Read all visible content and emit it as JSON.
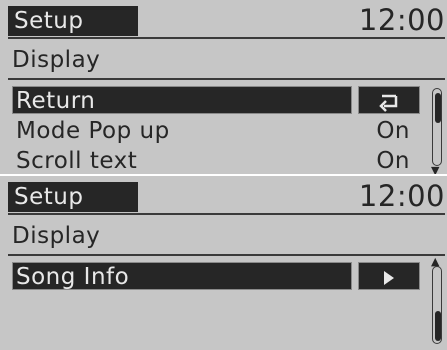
{
  "screens": [
    {
      "title": "Setup",
      "clock": "12:00",
      "subtitle": "Display",
      "rows": [
        {
          "label": "Return",
          "action_icon": "return-arrow-icon",
          "action_glyph": "⮌"
        },
        {
          "label": "Mode Pop up",
          "value": "On"
        },
        {
          "label": "Scroll text",
          "value": "On"
        }
      ],
      "scroll": {
        "position": 0,
        "arrow_down": "▼"
      }
    },
    {
      "title": "Setup",
      "clock": "12:00",
      "subtitle": "Display",
      "rows": [
        {
          "label": "Song Info",
          "action_icon": "play-arrow-icon",
          "action_glyph": "▶"
        }
      ],
      "scroll": {
        "position": 1,
        "arrow_up": "▲"
      }
    }
  ],
  "colors": {
    "screen_bg": "#c6c6c6",
    "dark": "#262626",
    "light_text": "#e8e8e8"
  }
}
